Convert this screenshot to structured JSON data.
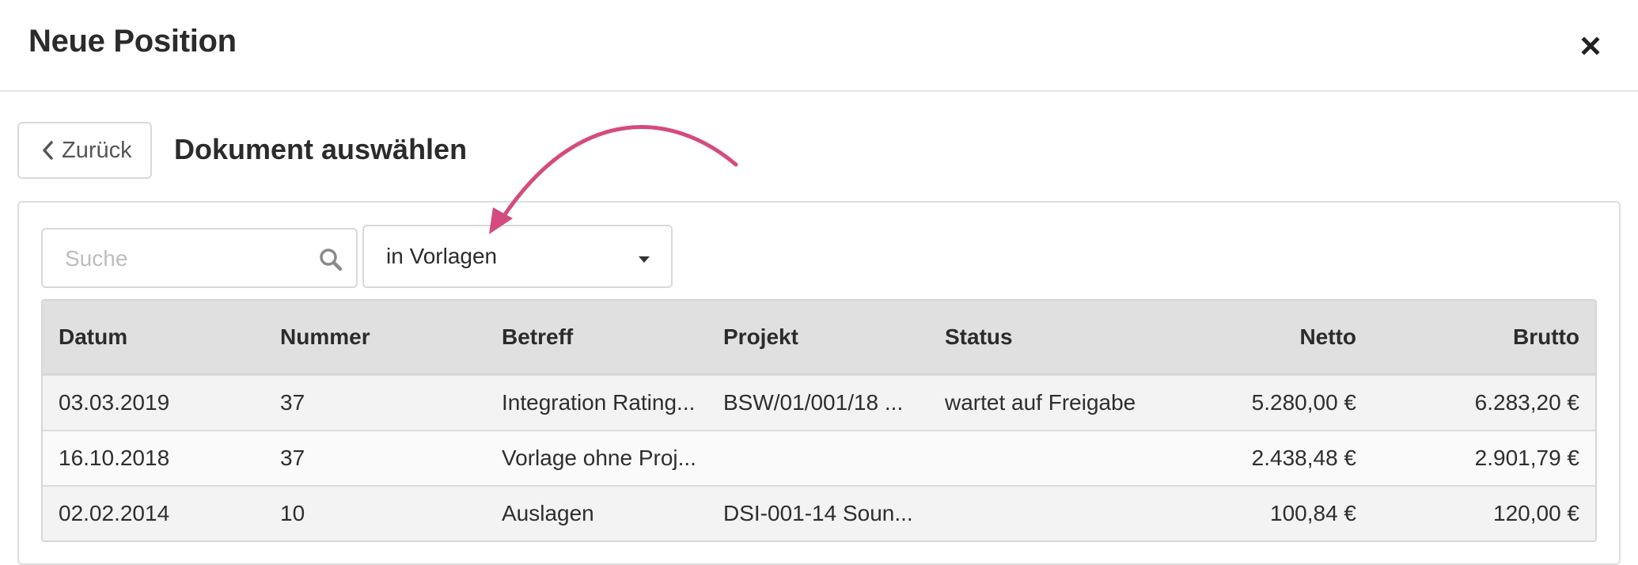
{
  "modal": {
    "title": "Neue Position",
    "close_icon": "close-icon"
  },
  "toolbar": {
    "back_label": "Zurück",
    "back_icon": "chevron-left-icon",
    "section_title": "Dokument auswählen"
  },
  "filters": {
    "search_placeholder": "Suche",
    "search_value": "",
    "search_icon": "search-icon",
    "select_value": "in Vorlagen",
    "select_icon": "caret-down-icon"
  },
  "annotation": {
    "type": "curved-arrow",
    "color": "#d44b7f",
    "points_to": "filter-select"
  },
  "table": {
    "columns": [
      "Datum",
      "Nummer",
      "Betreff",
      "Projekt",
      "Status",
      "Netto",
      "Brutto"
    ],
    "rows": [
      {
        "datum": "03.03.2019",
        "nummer": "37",
        "betreff": "Integration Rating...",
        "projekt": "BSW/01/001/18 ...",
        "status": "wartet auf Freigabe",
        "netto": "5.280,00 €",
        "brutto": "6.283,20 €"
      },
      {
        "datum": "16.10.2018",
        "nummer": "37",
        "betreff": "Vorlage ohne Proj...",
        "projekt": "",
        "status": "",
        "netto": "2.438,48 €",
        "brutto": "2.901,79 €"
      },
      {
        "datum": "02.02.2014",
        "nummer": "10",
        "betreff": "Auslagen",
        "projekt": "DSI-001-14 Soun...",
        "status": "",
        "netto": "100,84 €",
        "brutto": "120,00 €"
      }
    ]
  }
}
